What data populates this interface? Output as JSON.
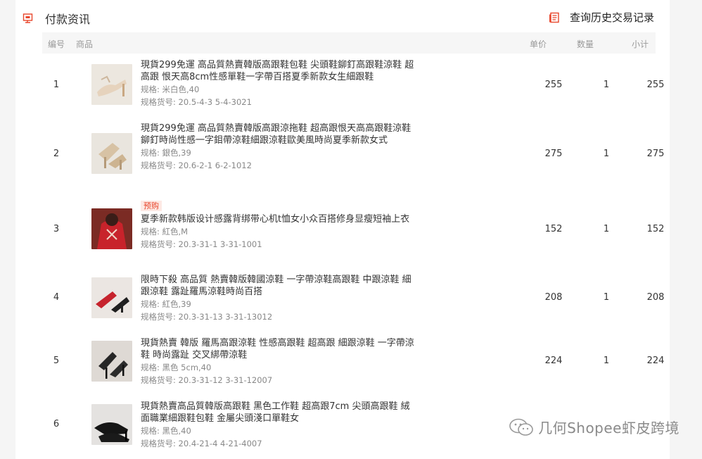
{
  "header": {
    "title": "付款资讯",
    "history_link": "查询历史交易记录",
    "accent": "#e8462c"
  },
  "table": {
    "columns": {
      "num": "编号",
      "product": "商品",
      "price": "单价",
      "qty": "数量",
      "subtotal": "小计"
    },
    "spec_label": "规格:",
    "sku_label": "规格货号:",
    "rows": [
      {
        "num": "1",
        "tag": "",
        "title": "現貨299免運 高品質熱賣韓版高跟鞋包鞋 尖頭鞋鉚釘高跟鞋涼鞋 超高跟 恨天高8cm性感單鞋一字帶百搭夏季新款女生細跟鞋",
        "spec": "米白色,40",
        "sku": "20.5-4-3 5-4-3021",
        "price": "255",
        "qty": "1",
        "subtotal": "255"
      },
      {
        "num": "2",
        "tag": "",
        "title": "現貨299免運 高品質熱賣韓版高跟涼拖鞋 超高跟恨天高高跟鞋涼鞋鉚釘時尚性感一字鉬帶涼鞋細跟涼鞋歐美風時尚夏季新款女式",
        "spec": "銀色,39",
        "sku": "20.6-2-1 6-2-1012",
        "price": "275",
        "qty": "1",
        "subtotal": "275"
      },
      {
        "num": "3",
        "tag": "预购",
        "title": "夏季新款韩版设计感露背绑带心机t恤女小众百搭修身显瘦短袖上衣",
        "spec": "紅色,M",
        "sku": "20.3-31-1 3-31-1001",
        "price": "152",
        "qty": "1",
        "subtotal": "152"
      },
      {
        "num": "4",
        "tag": "",
        "title": "限時下殺 高品質 熱賣韓版韓國涼鞋 一字帶涼鞋高跟鞋 中跟涼鞋 細跟涼鞋 露趾羅馬涼鞋時尚百搭",
        "spec": "紅色,39",
        "sku": "20.3-31-13 3-31-13012",
        "price": "208",
        "qty": "1",
        "subtotal": "208"
      },
      {
        "num": "5",
        "tag": "",
        "title": "現貨熱賣 韓版 羅馬高跟涼鞋 性感高跟鞋 超高跟 細跟涼鞋 一字帶涼鞋 時尚露趾 交叉綁帶涼鞋",
        "spec": "黑色 5cm,40",
        "sku": "20.3-31-12 3-31-12007",
        "price": "224",
        "qty": "1",
        "subtotal": "224"
      },
      {
        "num": "6",
        "tag": "",
        "title": "現貨熱賣高品質韓版高跟鞋 黑色工作鞋 超高跟7cm 尖頭高跟鞋 絨面職業細跟鞋包鞋 金屬尖頭淺口單鞋女",
        "spec": "黑色,40",
        "sku": "20.4-21-4 4-21-4007",
        "price": "",
        "qty": "",
        "subtotal": ""
      }
    ]
  },
  "watermark": {
    "text": "几何Shopee虾皮跨境"
  }
}
